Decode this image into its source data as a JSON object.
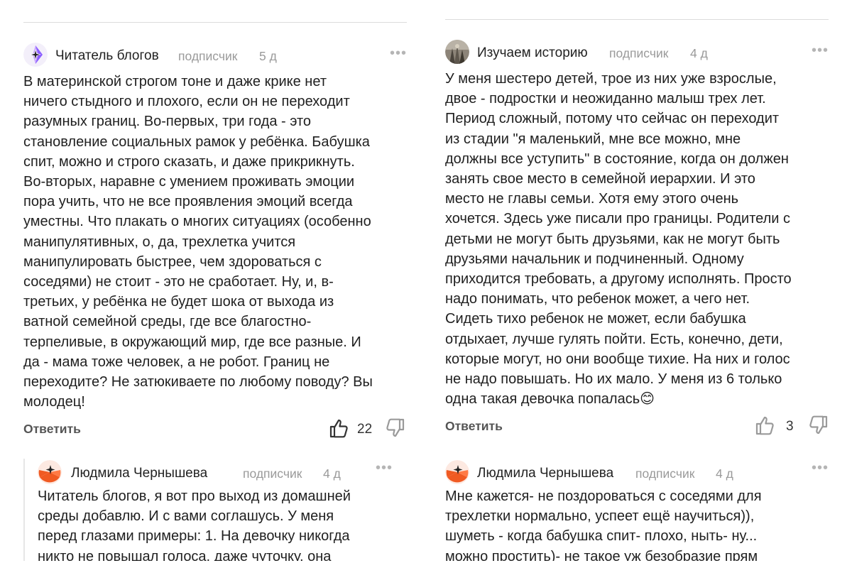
{
  "left": {
    "comment": {
      "author": "Читатель блогов",
      "role": "подписчик",
      "time": "5 д",
      "text": "В материнской строгом тоне и даже крике нет\nничего стыдного и плохого, если он не переходит\nразумных границ. Во-первых, три года - это\nстановление социальных рамок у ребёнка. Бабушка\nспит, можно и строго сказать, и даже прикрикнуть.\nВо-вторых, наравне с умением проживать эмоции\nпора учить, что не все проявления эмоций всегда\nуместны. Что плакать о многих ситуациях (особенно\nманипулятивных, о, да, трехлетка учится\nманипулировать быстрее, чем здороваться с\nсоседями) не стоит - это не сработает. Ну, и, в-\nтретьих, у ребёнка не будет шока от выхода из\nватной семейной среды, где все благостно-\nтерпеливые, в окружающий мир, где все разные. И\nда - мама тоже человек, а не робот. Границ не\nпереходите? Не затюкиваете по любому поводу? Вы\nмолодец!",
      "reply_label": "Ответить",
      "likes": "22"
    },
    "reply": {
      "author": "Людмила Чернышева",
      "role": "подписчик",
      "time": "4 д",
      "text": "Читатель блогов, я вот про выход из домашней\nсреды добавлю. И с вами соглашусь. У меня\nперед глазами примеры: 1. На девочку никогда\nникто не повышал голоса, даже чуточку, она"
    }
  },
  "right": {
    "comment": {
      "author": "Изучаем историю",
      "role": "подписчик",
      "time": "4 д",
      "text": "У меня шестеро детей, трое из них уже взрослые,\nдвое - подростки и неожиданно малыш трех лет.\nПериод сложный, потому что сейчас он переходит\nиз стадии \"я маленький, мне все можно, мне\nдолжны все уступить\" в состояние, когда он должен\nзанять свое место в семейной иерархии. И это\nместо не главы семьи. Хотя ему этого очень\nхочется. Здесь уже писали про границы. Родители с\nдетьми не могут быть друзьями, как не могут быть\nдрузьями начальник и подчиненный. Одному\nприходится требовать, а другому исполнять. Просто\nнадо понимать, что ребенок может, а чего нет.\nСидеть тихо ребенок не может, если бабушка\nотдыхает, лучше гулять пойти. Есть, конечно, дети,\nкоторые могут, но они вообще тихие. На них и голос\nне надо повышать. Но их мало. У меня из 6 только\nодна такая девочка попалась😊",
      "reply_label": "Ответить",
      "likes": "3"
    },
    "reply": {
      "author": "Людмила Чернышева",
      "role": "подписчик",
      "time": "4 д",
      "text": "Мне кажется- не поздороваться с соседями для\nтрехлетки нормально, успеет ещё научиться)),\nшуметь - когда бабушка спит- плохо, ныть- ну...\nможно простить)- не такое уж безобразие прям"
    }
  },
  "more_glyph": "•••",
  "colors": {
    "bg": "#ffffff",
    "text": "#1f1f1f",
    "muted": "#9a9a9a",
    "divider": "#dcdcdc",
    "avatar_orange": "#f05a22",
    "avatar_purple": "#8a5cff"
  },
  "icons": {
    "like": "thumbs-up-icon",
    "dislike": "thumbs-down-icon",
    "more": "more-dots-icon"
  }
}
